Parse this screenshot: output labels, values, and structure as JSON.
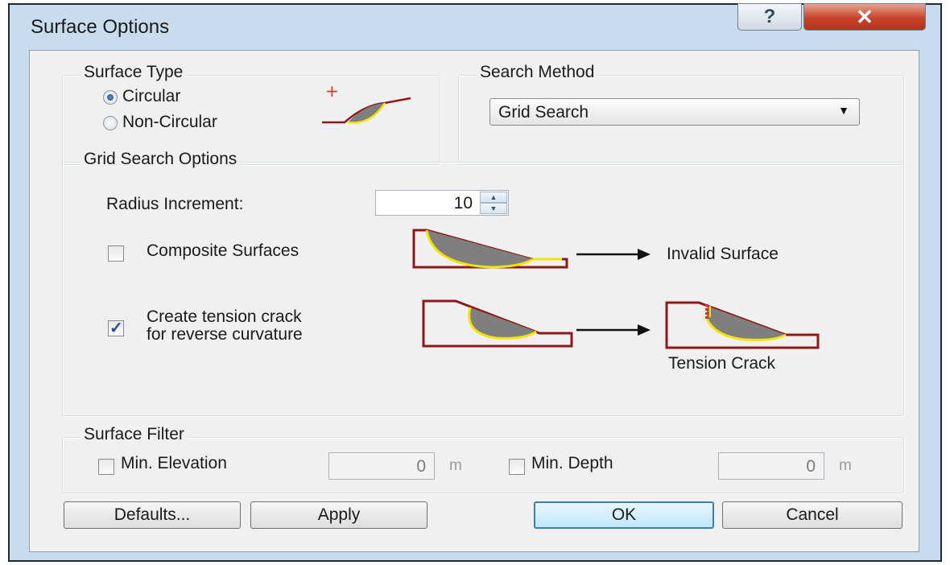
{
  "window": {
    "title": "Surface Options"
  },
  "surface_type": {
    "title": "Surface Type",
    "options": [
      {
        "label": "Circular",
        "selected": true
      },
      {
        "label": "Non-Circular",
        "selected": false
      }
    ]
  },
  "search_method": {
    "title": "Search Method",
    "selected": "Grid Search"
  },
  "grid_search_options": {
    "title": "Grid Search Options",
    "radius_increment": {
      "label": "Radius Increment:",
      "value": "10"
    },
    "composite_surfaces": {
      "label": "Composite Surfaces",
      "checked": false,
      "result_label": "Invalid Surface"
    },
    "tension_crack": {
      "label_line1": "Create tension crack",
      "label_line2": "for reverse curvature",
      "checked": true,
      "result_label": "Tension Crack"
    }
  },
  "surface_filter": {
    "title": "Surface Filter",
    "min_elevation": {
      "label": "Min. Elevation",
      "value": "0",
      "unit": "m",
      "checked": false
    },
    "min_depth": {
      "label": "Min. Depth",
      "value": "0",
      "unit": "m",
      "checked": false
    }
  },
  "buttons": {
    "defaults": "Defaults...",
    "apply": "Apply",
    "ok": "OK",
    "cancel": "Cancel"
  },
  "colors": {
    "window_frame": "#c9dcee",
    "dialog_bg": "#f0f0f0",
    "close_red": "#c8412a",
    "slope_outline": "#8b1a1a",
    "slip_mass": "#7f7f7f",
    "slip_surface": "#f5e400",
    "crack": "#e03020"
  }
}
